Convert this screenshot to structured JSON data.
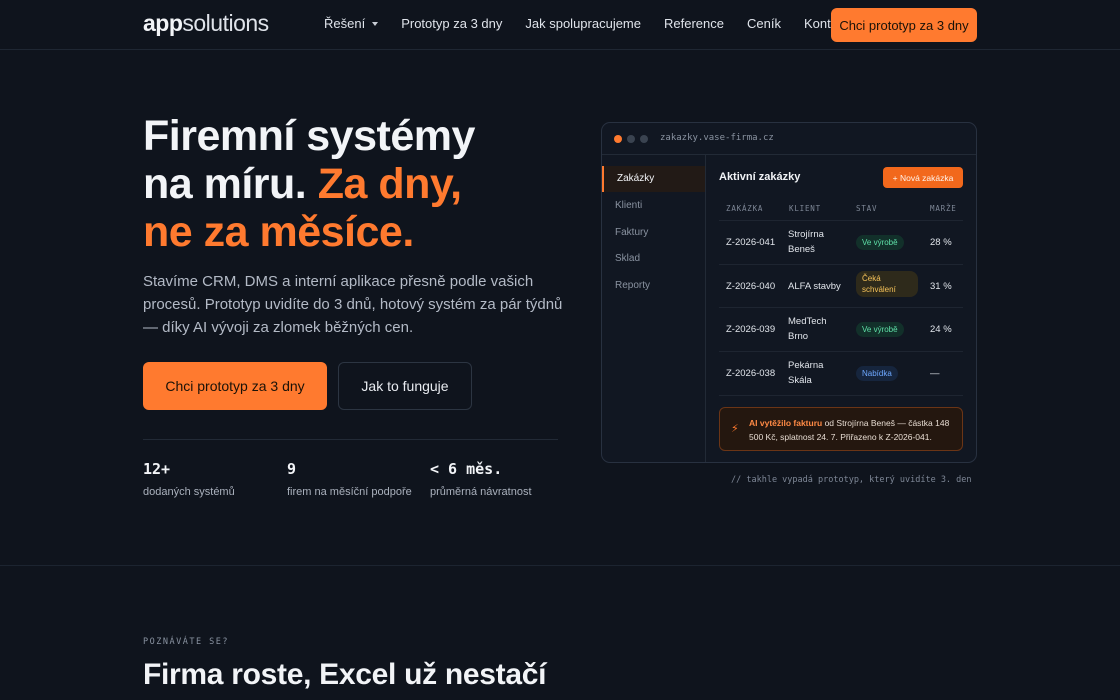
{
  "nav": {
    "logo_bold": "app",
    "logo_light": "solutions",
    "links": [
      "Řešení",
      "Prototyp za 3 dny",
      "Jak spolupracujeme",
      "Reference",
      "Ceník",
      "Kontakt"
    ],
    "cta": "Chci prototyp za 3 dny"
  },
  "hero": {
    "title_line1": "Firemní systémy",
    "title_line2a": "na míru. ",
    "title_line2b": "Za dny,",
    "title_line3": "ne za měsíce.",
    "subtitle": "Stavíme CRM, DMS a interní aplikace přesně podle vašich procesů. Prototyp uvidíte do 3 dnů, hotový systém za pár týdnů — díky AI vývoji za zlomek běžných cen.",
    "primary_button": "Chci prototyp za 3 dny",
    "secondary_button": "Jak to funguje",
    "stats": [
      {
        "num": "12+",
        "label": "dodaných systémů"
      },
      {
        "num": "9",
        "label": "firem na měsíční podpoře"
      },
      {
        "num": "< 6 měs.",
        "label": "průměrná návratnost"
      }
    ]
  },
  "mockup": {
    "url": "zakazky.vase-firma.cz",
    "sidebar": [
      "Zakázky",
      "Klienti",
      "Faktury",
      "Sklad",
      "Reporty"
    ],
    "title": "Aktivní zakázky",
    "new_button": "+ Nová zakázka",
    "columns": [
      "ZAKÁZKA",
      "KLIENT",
      "STAV",
      "MARŽE"
    ],
    "rows": [
      {
        "id": "Z-2026-041",
        "client": "Strojírna Beneš",
        "status": "Ve výrobě",
        "margin": "28 %"
      },
      {
        "id": "Z-2026-040",
        "client": "ALFA stavby",
        "status": "Čeká schválení",
        "margin": "31 %"
      },
      {
        "id": "Z-2026-039",
        "client": "MedTech Brno",
        "status": "Ve výrobě",
        "margin": "24 %"
      },
      {
        "id": "Z-2026-038",
        "client": "Pekárna Skála",
        "status": "Nabídka",
        "margin": "—"
      }
    ],
    "ai_highlight": "AI vytěžilo fakturu",
    "ai_text": " od Strojírna Beneš — částka 148 500 Kč, splatnost 24. 7. Přiřazeno k Z-2026-041.",
    "caption": "// takhle vypadá prototyp, který uvidíte 3. den",
    "colors": {
      "accent": "#ff7a2f",
      "green": "#5fe0a8",
      "yellow": "#f6c35a",
      "blue": "#6ea8ff"
    }
  },
  "section2": {
    "eyebrow": "POZNÁVÁTE SE?",
    "title": "Firma roste, Excel už nestačí"
  }
}
